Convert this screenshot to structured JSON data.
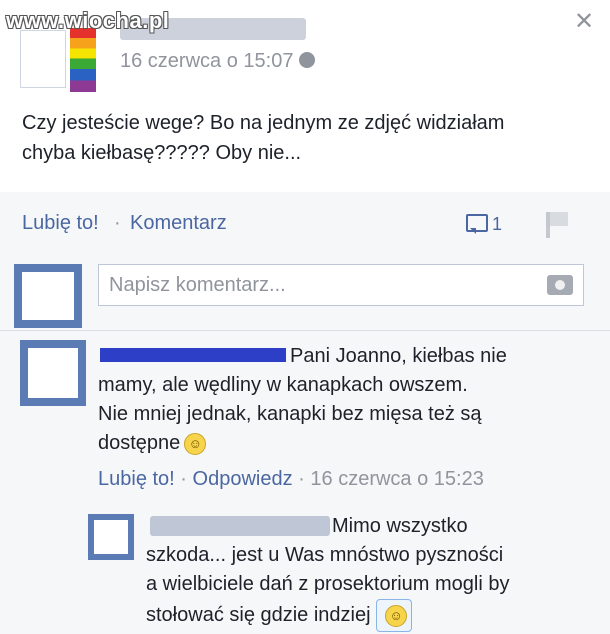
{
  "watermark": "www.wiocha.pl",
  "post": {
    "time": "16 czerwca o 15:07",
    "text_line1": "Czy jesteście wege? Bo na jednym ze zdjęć widziałam",
    "text_line2": "chyba kiełbasę????? Oby nie...",
    "icons": {
      "privacy": "globe-icon",
      "close": "close-icon"
    }
  },
  "actions": {
    "like": "Lubię to!",
    "separator": "·",
    "comment": "Komentarz",
    "comment_count": "1"
  },
  "comment_box": {
    "placeholder": "Napisz komentarz..."
  },
  "comments": [
    {
      "text_line1": "Pani Joanno, kiełbas nie",
      "text_line2": "mamy, ale wędliny w kanapkach owszem.",
      "text_line3": "Nie mniej jednak, kanapki bez mięsa też są",
      "text_line4": "dostępne",
      "like": "Lubię to!",
      "reply": "Odpowiedz",
      "time": "16 czerwca o 15:23"
    },
    {
      "text_line1": "Mimo wszystko",
      "text_line2": "szkoda... jest u Was mnóstwo pyszności",
      "text_line3": "a wielbiciele dań z prosektorium mogli by",
      "text_line4": "stołować się gdzie indziej"
    }
  ]
}
